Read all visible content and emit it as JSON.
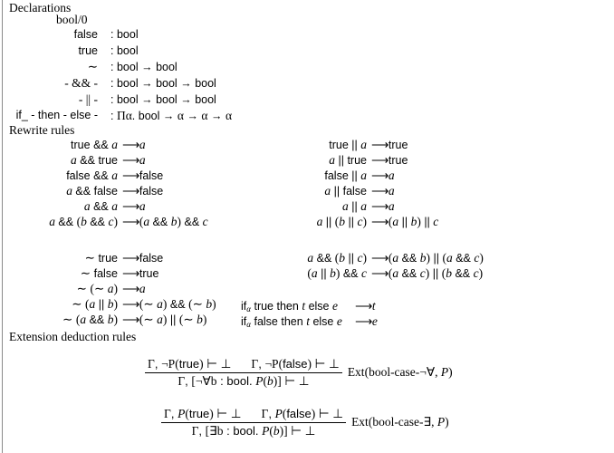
{
  "document": {
    "sections": {
      "declarations_heading": "Declarations",
      "rewrite_heading": "Rewrite rules",
      "extension_heading": "Extension deduction rules"
    },
    "declarations": {
      "sort": "bool/0",
      "entries": [
        {
          "name": "false",
          "type": ": bool"
        },
        {
          "name": "true",
          "type": ": bool"
        },
        {
          "name": "∼",
          "type": ": bool → bool"
        },
        {
          "name": "- && -",
          "type": ": bool → bool → bool"
        },
        {
          "name": "- || -",
          "type": ": bool → bool → bool"
        },
        {
          "name": "if_ - then - else -",
          "type": ": Πα. bool → α → α → α"
        }
      ]
    },
    "rewrite_rules": {
      "block1_left": [
        {
          "lhs": "true && a",
          "rhs": "a"
        },
        {
          "lhs": "a && true",
          "rhs": "a"
        },
        {
          "lhs": "false && a",
          "rhs": "false"
        },
        {
          "lhs": "a && false",
          "rhs": "false"
        },
        {
          "lhs": "a && a",
          "rhs": "a"
        },
        {
          "lhs": "a && (b && c)",
          "rhs": "(a && b) && c"
        }
      ],
      "block1_right": [
        {
          "lhs": "true || a",
          "rhs": "true"
        },
        {
          "lhs": "a || true",
          "rhs": "true"
        },
        {
          "lhs": "false || a",
          "rhs": "a"
        },
        {
          "lhs": "a || false",
          "rhs": "a"
        },
        {
          "lhs": "a || a",
          "rhs": "a"
        },
        {
          "lhs": "a || (b || c)",
          "rhs": "(a || b) || c"
        }
      ],
      "block2_left": [
        {
          "lhs": "∼ true",
          "rhs": "false"
        },
        {
          "lhs": "∼ false",
          "rhs": "true"
        },
        {
          "lhs": "∼ (∼ a)",
          "rhs": "a"
        },
        {
          "lhs": "∼ (a || b)",
          "rhs": "(∼ a) && (∼ b)"
        },
        {
          "lhs": "∼ (a && b)",
          "rhs": "(∼ a) || (∼ b)"
        }
      ],
      "block2_right": [
        {
          "lhs": "a && (b || c)",
          "rhs": "(a && b) || (a && c)"
        },
        {
          "lhs": "(a || b) && c",
          "rhs": "(a && c) || (b && c)"
        }
      ],
      "if_rules": [
        {
          "lhs": "ifα true then t else e",
          "rhs": "t"
        },
        {
          "lhs": "ifα false then t else e",
          "rhs": "e"
        }
      ],
      "arrow": "⟶"
    },
    "extension_rules": [
      {
        "premise_left": "Γ, ¬P(true) ⊢ ⊥",
        "premise_right": "Γ, ¬P(false) ⊢ ⊥",
        "conclusion": "Γ, [¬∀b : bool. P(b)] ⊢ ⊥",
        "label": "Ext(bool-case-¬∀, P)"
      },
      {
        "premise_left": "Γ, P(true) ⊢ ⊥",
        "premise_right": "Γ, P(false) ⊢ ⊥",
        "conclusion": "Γ, [∃b : bool. P(b)] ⊢ ⊥",
        "label": "Ext(bool-case-∃, P)"
      }
    ]
  }
}
